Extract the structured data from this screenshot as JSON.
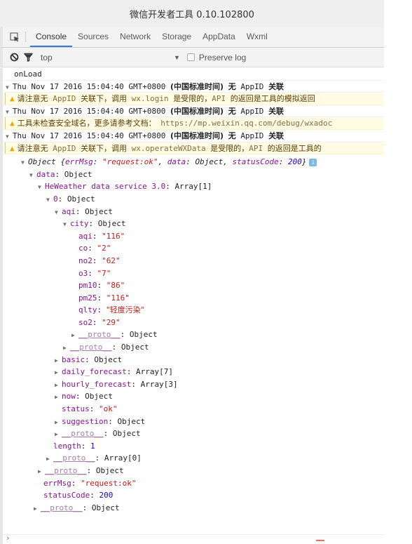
{
  "window": {
    "title": "微信开发者工具 0.10.102800"
  },
  "tabs": [
    {
      "label": "Console",
      "active": true
    },
    {
      "label": "Sources",
      "active": false
    },
    {
      "label": "Network",
      "active": false
    },
    {
      "label": "Storage",
      "active": false
    },
    {
      "label": "AppData",
      "active": false
    },
    {
      "label": "Wxml",
      "active": false
    }
  ],
  "toolbar": {
    "context": "top",
    "preserve_log_label": "Preserve log",
    "preserve_log_checked": false
  },
  "console": {
    "log_onload": "onLoad",
    "groups": [
      {
        "header_date": "Thu Nov 17 2016 15:04:40 GMT+0800",
        "header_tz": "(中国标准时间)",
        "header_tail_cn": "无",
        "header_appid": "AppID",
        "header_rel": "关联",
        "warning": {
          "p1": "请注意无",
          "p2": "AppID",
          "p3": "关联下，调用",
          "p4": "wx.login",
          "p5": "是受限的，",
          "p6": "API",
          "p7": "的返回是工具的模拟返回"
        }
      },
      {
        "header_date": "Thu Nov 17 2016 15:04:40 GMT+0800",
        "header_tz": "(中国标准时间)",
        "header_tail_cn": "无",
        "header_appid": "AppID",
        "header_rel": "关联",
        "warning": {
          "p1": "工具未检查安全域名，更多请参考文档：",
          "p2": "https://mp.weixin.qq.com/debug/wxadoc"
        }
      },
      {
        "header_date": "Thu Nov 17 2016 15:04:40 GMT+0800",
        "header_tz": "(中国标准时间)",
        "header_tail_cn": "无",
        "header_appid": "AppID",
        "header_rel": "关联",
        "warning": {
          "p1": "请注意无",
          "p2": "AppID",
          "p3": "关联下，调用",
          "p4": "wx.operateWXData",
          "p5": "是受限的，",
          "p6": "API",
          "p7": "的返回是工具的"
        }
      }
    ],
    "object_summary": {
      "prefix": "Object {",
      "errMsg_key": "errMsg",
      "errMsg_val": "\"request:ok\"",
      "data_key": "data",
      "data_val": "Object",
      "statusCode_key": "statusCode",
      "statusCode_val": "200",
      "suffix": "}",
      "badge": "i"
    },
    "tree": {
      "data_key": "data",
      "data_type": "Object",
      "hw_key": "HeWeather data service 3.0",
      "hw_type": "Array[1]",
      "idx_key": "0",
      "idx_type": "Object",
      "aqi_key": "aqi",
      "aqi_type": "Object",
      "city_key": "city",
      "city_type": "Object",
      "city_fields": [
        {
          "key": "aqi",
          "value": "\"116\""
        },
        {
          "key": "co",
          "value": "\"2\""
        },
        {
          "key": "no2",
          "value": "\"62\""
        },
        {
          "key": "o3",
          "value": "\"7\""
        },
        {
          "key": "pm10",
          "value": "\"86\""
        },
        {
          "key": "pm25",
          "value": "\"116\""
        },
        {
          "key": "qlty",
          "value": "\"轻度污染\""
        },
        {
          "key": "so2",
          "value": "\"29\""
        }
      ],
      "proto_key": "__proto__",
      "object_type": "Object",
      "basic_key": "basic",
      "basic_type": "Object",
      "daily_key": "daily_forecast",
      "daily_type": "Array[7]",
      "hourly_key": "hourly_forecast",
      "hourly_type": "Array[3]",
      "now_key": "now",
      "now_type": "Object",
      "status_key": "status",
      "status_val": "\"ok\"",
      "suggestion_key": "suggestion",
      "suggestion_type": "Object",
      "length_key": "length",
      "length_val": "1",
      "array_proto_type": "Array[0]",
      "errMsg_key": "errMsg",
      "errMsg_val": "\"request:ok\"",
      "statusCode_key": "statusCode",
      "statusCode_val": "200"
    },
    "prompt": "›"
  }
}
